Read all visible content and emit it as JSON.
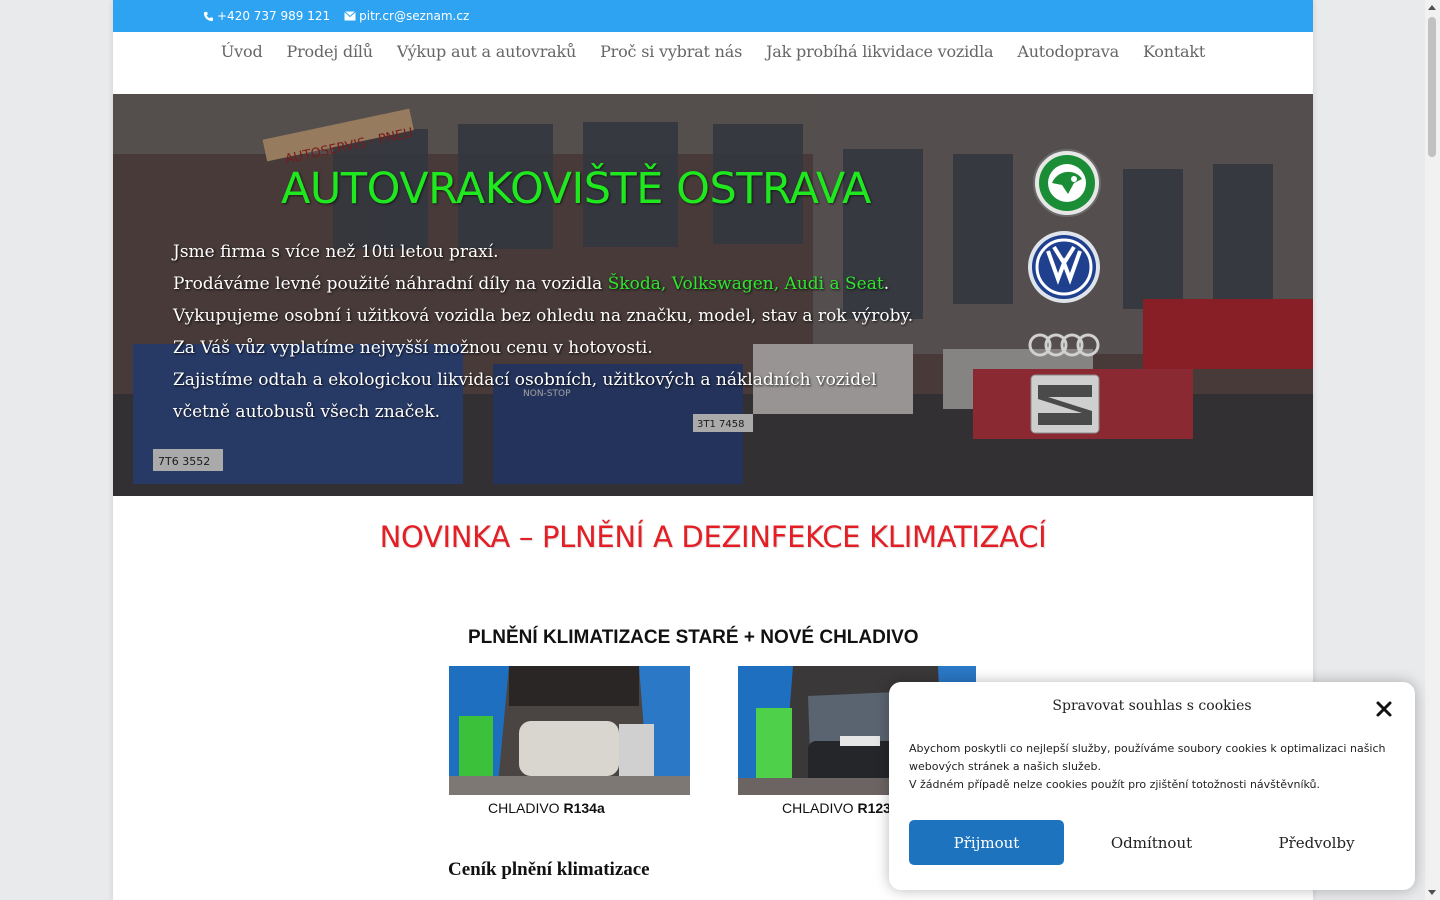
{
  "topbar": {
    "phone": "+420 737 989 121",
    "email": "pitr.cr@seznam.cz"
  },
  "nav": [
    "Úvod",
    "Prodej dílů",
    "Výkup aut a autovraků",
    "Proč si vybrat nás",
    "Jak probíhá likvidace vozidla",
    "Autodoprava",
    "Kontakt"
  ],
  "hero": {
    "title": "AUTOVRAKOVIŠTĚ OSTRAVA",
    "line1": "Jsme firma s více než 10ti letou praxí.",
    "line2_pre": "Prodáváme levné použité náhradní díly na vozidla ",
    "line2_brands": "Škoda, Volkswagen, Audi a Seat",
    "line2_post": ".",
    "line3": "Vykupujeme osobní i užitková vozidla bez ohledu na značku, model, stav a rok výroby.",
    "line4": "Za Váš vůz vyplatíme nejvyšší možnou cenu v hotovosti.",
    "line5": "Zajistíme odtah a ekologickou likvidací osobních, užitkových a nákladních vozidel včetně autobusů všech značek.",
    "banner_sign": "AUTOSERVIS - PNEU",
    "plates": [
      "7T6 3552",
      "3T1 7458"
    ],
    "truck_label": "NON-STOP"
  },
  "main": {
    "section_title": "NOVINKA – PLNĚNÍ A DEZINFEKCE KLIMATIZACÍ",
    "sub_title": "PLNĚNÍ KLIMATIZACE STARÉ + NOVÉ CHLADIVO",
    "caption1_pre": "CHLADIVO ",
    "caption1_bold": "R134a",
    "caption2_pre": "CHLADIVO ",
    "caption2_bold": "R123",
    "price_title": "Ceník plnění klimatizace"
  },
  "cookie": {
    "title": "Spravovat souhlas s cookies",
    "text1": "Abychom poskytli co nejlepší služby, používáme soubory cookies k optimalizaci našich webových stránek a našich služeb.",
    "text2": "V žádném případě nelze cookies použít pro zjištění totožnosti návštěvníků.",
    "accept": "Přijmout",
    "deny": "Odmítnout",
    "prefs": "Předvolby"
  },
  "colors": {
    "topbar": "#2ea3f2",
    "hero_title": "#1fe81f",
    "section_title": "#e31e25",
    "accept_button": "#1e73be"
  },
  "icons": [
    "phone-icon",
    "mail-icon",
    "skoda-logo",
    "volkswagen-logo",
    "audi-logo",
    "seat-logo",
    "close-icon"
  ]
}
